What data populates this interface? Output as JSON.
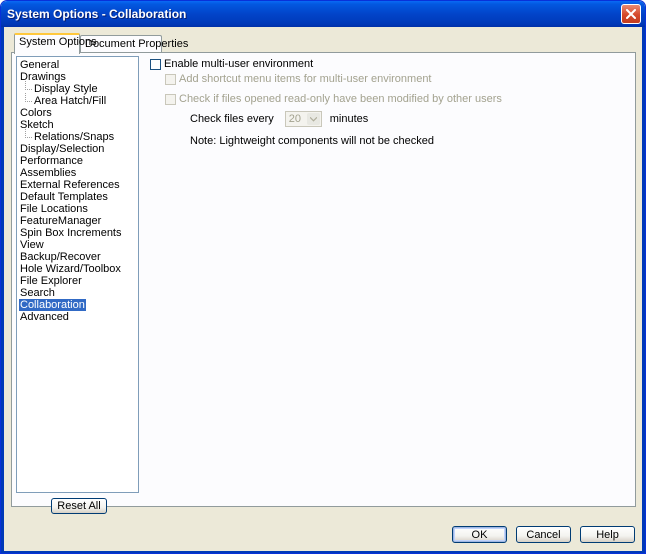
{
  "window": {
    "title": "System Options - Collaboration"
  },
  "tabs": [
    {
      "label": "System Options",
      "active": true
    },
    {
      "label": "Document Properties",
      "active": false
    }
  ],
  "tree": {
    "items": [
      {
        "label": "General",
        "level": 0,
        "selected": false
      },
      {
        "label": "Drawings",
        "level": 0,
        "selected": false
      },
      {
        "label": "Display Style",
        "level": 1,
        "selected": false
      },
      {
        "label": "Area Hatch/Fill",
        "level": 1,
        "selected": false
      },
      {
        "label": "Colors",
        "level": 0,
        "selected": false
      },
      {
        "label": "Sketch",
        "level": 0,
        "selected": false
      },
      {
        "label": "Relations/Snaps",
        "level": 1,
        "selected": false
      },
      {
        "label": "Display/Selection",
        "level": 0,
        "selected": false
      },
      {
        "label": "Performance",
        "level": 0,
        "selected": false
      },
      {
        "label": "Assemblies",
        "level": 0,
        "selected": false
      },
      {
        "label": "External References",
        "level": 0,
        "selected": false
      },
      {
        "label": "Default Templates",
        "level": 0,
        "selected": false
      },
      {
        "label": "File Locations",
        "level": 0,
        "selected": false
      },
      {
        "label": "FeatureManager",
        "level": 0,
        "selected": false
      },
      {
        "label": "Spin Box Increments",
        "level": 0,
        "selected": false
      },
      {
        "label": "View",
        "level": 0,
        "selected": false
      },
      {
        "label": "Backup/Recover",
        "level": 0,
        "selected": false
      },
      {
        "label": "Hole Wizard/Toolbox",
        "level": 0,
        "selected": false
      },
      {
        "label": "File Explorer",
        "level": 0,
        "selected": false
      },
      {
        "label": "Search",
        "level": 0,
        "selected": false
      },
      {
        "label": "Collaboration",
        "level": 0,
        "selected": true
      },
      {
        "label": "Advanced",
        "level": 0,
        "selected": false
      }
    ]
  },
  "options": {
    "enable_multi_user": {
      "label": "Enable multi-user environment",
      "checked": false,
      "enabled": true
    },
    "add_shortcut": {
      "label": "Add shortcut menu items for multi-user environment",
      "checked": false,
      "enabled": false
    },
    "check_readonly": {
      "label": "Check if files opened read-only have been modified by other users",
      "checked": false,
      "enabled": false
    },
    "check_files_every": {
      "label": "Check files every",
      "value": "20",
      "unit": "minutes"
    },
    "note": "Note: Lightweight components will not be checked"
  },
  "buttons": {
    "reset_all": "Reset All",
    "ok": "OK",
    "cancel": "Cancel",
    "help": "Help"
  },
  "colors": {
    "titlebar": "#0244c9",
    "selection": "#316ac5",
    "dialog_bg": "#ece9d8",
    "close_button": "#d6482a"
  }
}
